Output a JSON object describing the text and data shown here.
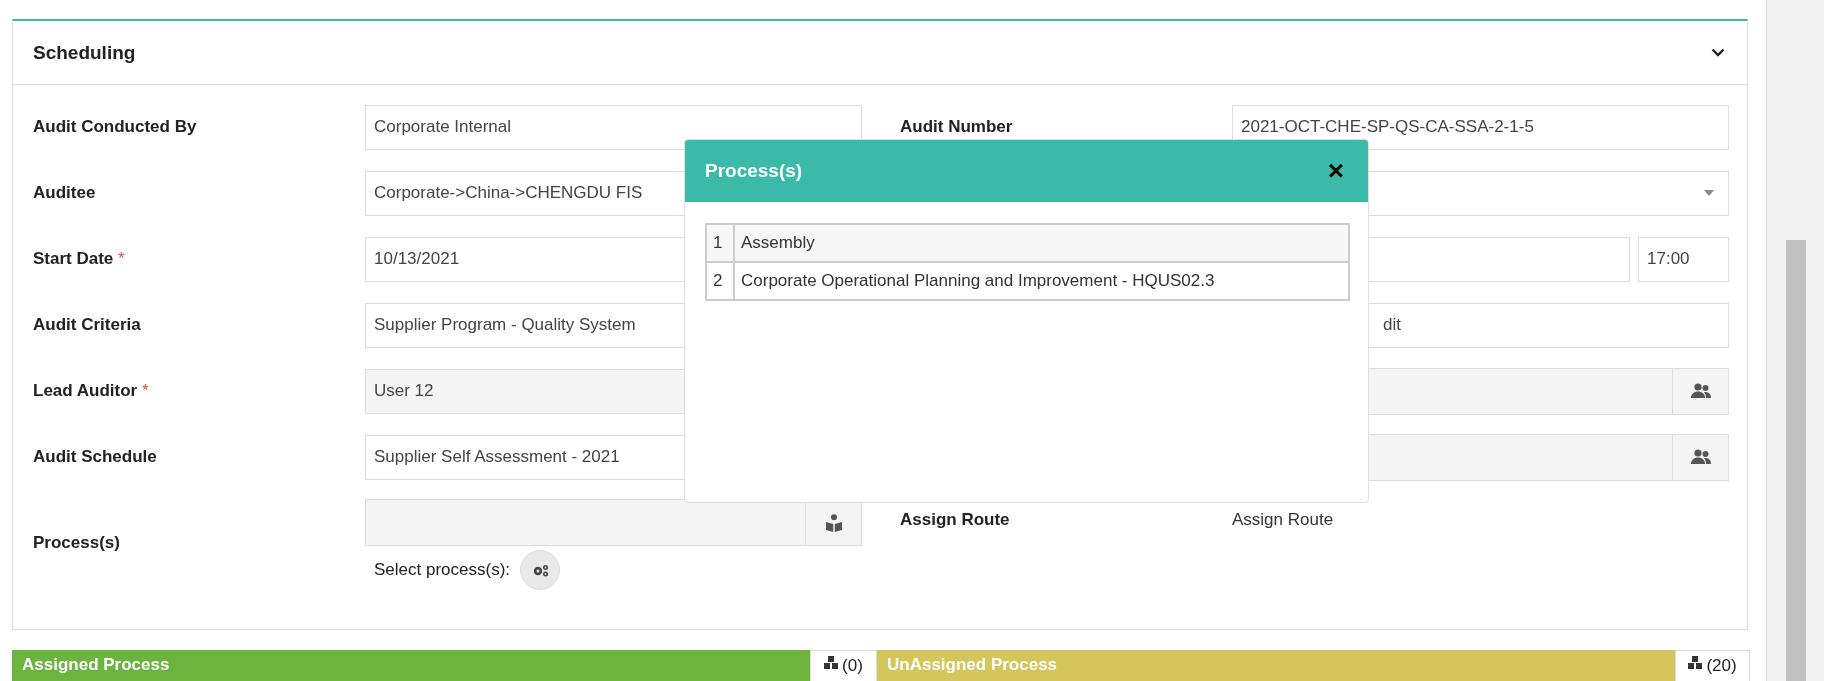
{
  "panel": {
    "title": "Scheduling",
    "expanded": true
  },
  "rows": [
    {
      "left": {
        "label": "Audit Conducted By",
        "kind": "text",
        "value": "Corporate Internal"
      },
      "right": {
        "label": "Audit Number",
        "kind": "text",
        "value": "2021-OCT-CHE-SP-QS-CA-SSA-2-1-5"
      }
    },
    {
      "left": {
        "label": "Auditee",
        "kind": "text",
        "value": "Corporate->China->CHENGDU FIS"
      },
      "right": {
        "kind": "select"
      }
    },
    {
      "left": {
        "label": "Start Date",
        "required_mark": "*",
        "kind": "text",
        "value": "10/13/2021"
      },
      "right": {
        "kind": "datetime",
        "time": "17:00"
      }
    },
    {
      "left": {
        "label": "Audit Criteria",
        "kind": "text",
        "value": "Supplier Program - Quality System"
      },
      "right": {
        "kind": "text",
        "value": "dit"
      }
    },
    {
      "left": {
        "label": "Lead Auditor",
        "required_mark": "*",
        "kind": "readonly",
        "value": "User 12"
      },
      "right": {
        "kind": "user_lookup"
      }
    },
    {
      "left": {
        "label": "Audit Schedule",
        "kind": "text",
        "value": "Supplier Self Assessment - 2021"
      },
      "right": {
        "kind": "user_lookup"
      }
    },
    {
      "left": {
        "label": "Process(s)",
        "kind": "process_lookup",
        "select_label": "Select process(s):"
      },
      "right": {
        "label": "Assign Route",
        "kind": "static",
        "value": "Assign Route"
      }
    }
  ],
  "modal": {
    "title": "Process(s)",
    "close": "×",
    "rows": [
      {
        "index": "1",
        "name": "Assembly"
      },
      {
        "index": "2",
        "name": "Corporate Operational Planning and Improvement - HQUS02.3"
      }
    ]
  },
  "process_bars": [
    {
      "title": "Assigned Process",
      "count": "(0)",
      "color": "#6db33f"
    },
    {
      "title": "UnAssigned Process",
      "count": "(20)",
      "color": "#d4c65a"
    }
  ]
}
